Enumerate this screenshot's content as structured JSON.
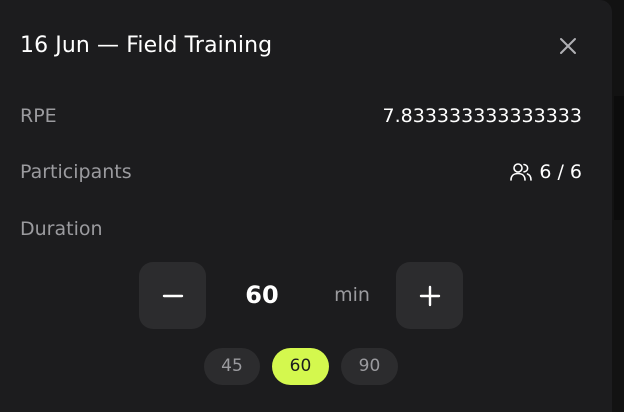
{
  "modal": {
    "title": "16 Jun — Field Training",
    "close_icon": "close-icon"
  },
  "rows": {
    "rpe": {
      "label": "RPE",
      "value": "7.833333333333333"
    },
    "participants": {
      "label": "Participants",
      "value": "6 / 6",
      "icon": "users-icon"
    },
    "duration": {
      "label": "Duration"
    }
  },
  "stepper": {
    "value": "60",
    "unit": "min",
    "decrement_icon": "minus-icon",
    "increment_icon": "plus-icon"
  },
  "presets": [
    {
      "label": "45",
      "active": false
    },
    {
      "label": "60",
      "active": true
    },
    {
      "label": "90",
      "active": false
    }
  ],
  "colors": {
    "accent": "#d4f84e",
    "surface": "#1c1c1e",
    "button": "#2c2c2e",
    "muted_text": "#9b9b9f"
  }
}
